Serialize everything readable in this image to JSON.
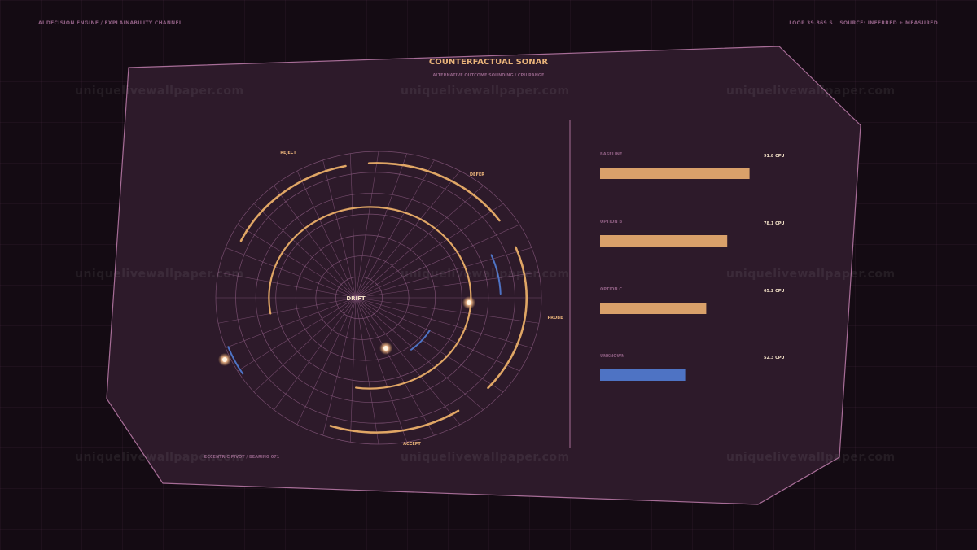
{
  "header": {
    "left": "AI DECISION ENGINE / EXPLAINABILITY CHANNEL",
    "right_loop": "LOOP 39.869 S",
    "right_source": "SOURCE: INFERRED + MEASURED"
  },
  "panel": {
    "title": "COUNTERFACTUAL SONAR",
    "subtitle": "ALTERNATIVE OUTCOME SOUNDING / CPU RANGE",
    "footer": "ECCENTRIC PIVOT / BEARING 071"
  },
  "radar": {
    "center_label": "DRIFT",
    "directions": {
      "reject": "REJECT",
      "defer": "DEFER",
      "probe": "PROBE",
      "accept": "ACCEPT"
    }
  },
  "bars": [
    {
      "label": "BASELINE",
      "value_text": "91.8 CPU",
      "value": 91.8,
      "color": "#d9a06a"
    },
    {
      "label": "OPTION B",
      "value_text": "78.1 CPU",
      "value": 78.1,
      "color": "#d9a06a"
    },
    {
      "label": "OPTION C",
      "value_text": "65.2 CPU",
      "value": 65.2,
      "color": "#d9a06a"
    },
    {
      "label": "UNKNOWN",
      "value_text": "52.3 CPU",
      "value": 52.3,
      "color": "#4e73c4"
    }
  ],
  "bar_max": 100,
  "watermark": "uniquelivewallpaper.com",
  "colors": {
    "panel_fill": "#2d1a2a",
    "panel_stroke": "#a76d97",
    "grid_line": "#8a5a80",
    "accent_orange": "#e0a665",
    "accent_blue": "#4e73c4",
    "title": "#e8b27a",
    "muted_text": "#8c5d80"
  }
}
